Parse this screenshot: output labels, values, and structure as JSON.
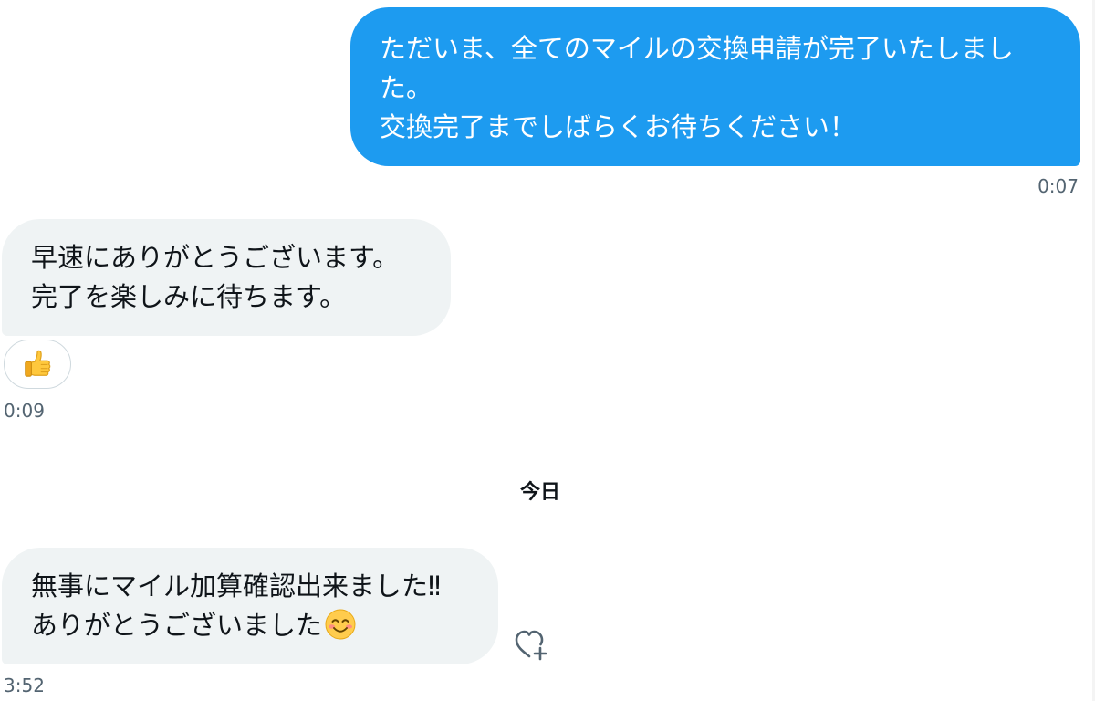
{
  "conversation": {
    "messages": [
      {
        "direction": "sent",
        "lines": [
          "ただいま、全てのマイルの交換申請が完了いたしまし",
          "た。",
          "交換完了までしばらくお待ちください！"
        ],
        "time": "0:07",
        "bubble_color": "#1d9bf0"
      },
      {
        "direction": "received",
        "lines": [
          "早速にありがとうございます。",
          "完了を楽しみに待ちます。"
        ],
        "time": "0:09",
        "reaction_icon": "thumbs-up-icon",
        "bubble_color": "#eff3f4"
      },
      {
        "direction": "received",
        "lines": [
          "無事にマイル加算確認出来ました‼︎",
          "ありがとうございました"
        ],
        "trailing_icon": "smiling-face-icon",
        "time": "3:52",
        "action_icon": "heart-plus-icon",
        "bubble_color": "#eff3f4"
      }
    ],
    "date_separator": "今日"
  },
  "colors": {
    "accent": "#1d9bf0",
    "received_bubble": "#eff3f4",
    "timestamp": "#536471"
  }
}
